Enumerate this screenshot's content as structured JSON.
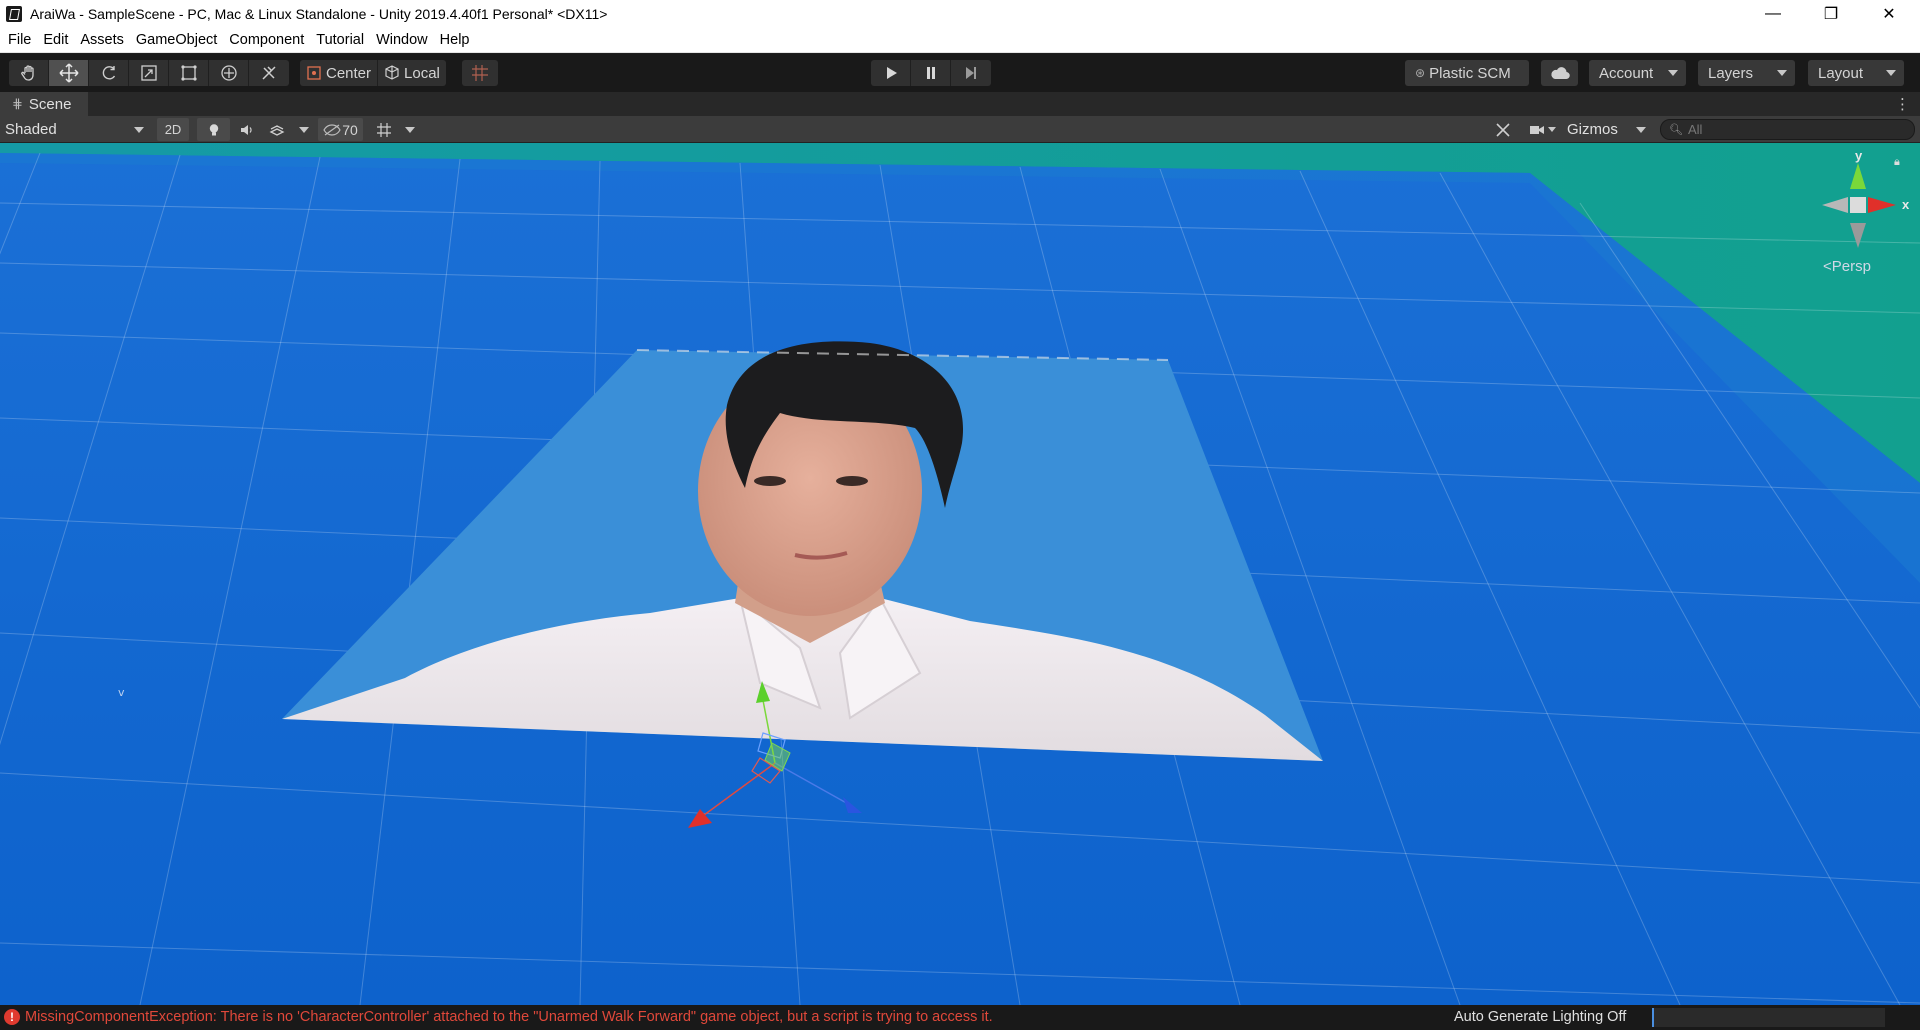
{
  "window": {
    "title": "AraiWa - SampleScene - PC, Mac & Linux Standalone - Unity 2019.4.40f1 Personal* <DX11>",
    "controls": {
      "minimize": "—",
      "restore": "❐",
      "close": "✕"
    }
  },
  "menu": [
    "File",
    "Edit",
    "Assets",
    "GameObject",
    "Component",
    "Tutorial",
    "Window",
    "Help"
  ],
  "toolbar": {
    "tools": [
      "hand-tool",
      "move-tool",
      "rotate-tool",
      "scale-tool",
      "rect-tool",
      "transform-tool",
      "custom-editor-tool"
    ],
    "active_tool": "move-tool",
    "pivot_mode": "Center",
    "pivot_rotation": "Local",
    "plastic_scm": "Plastic SCM",
    "account": "Account",
    "layers": "Layers",
    "layout": "Layout"
  },
  "scene_tab": {
    "label": "Scene"
  },
  "scene_toolbar": {
    "draw_mode": "Shaded",
    "mode_2d": "2D",
    "hidden_count": "70",
    "gizmos": "Gizmos",
    "search_placeholder": "All"
  },
  "viewport": {
    "camera_mode": "Persp",
    "axis_y": "y",
    "axis_x": "x",
    "colors": {
      "ground": "#1168d0",
      "horizon": "#149b9c",
      "photo_bg": "#3a8fd8",
      "shirt": "#ece6ea"
    }
  },
  "status": {
    "error_message": "MissingComponentException: There is no 'CharacterController' attached to the \"Unarmed Walk Forward\" game object, but a script is trying to access it.",
    "lighting": "Auto Generate Lighting Off"
  }
}
